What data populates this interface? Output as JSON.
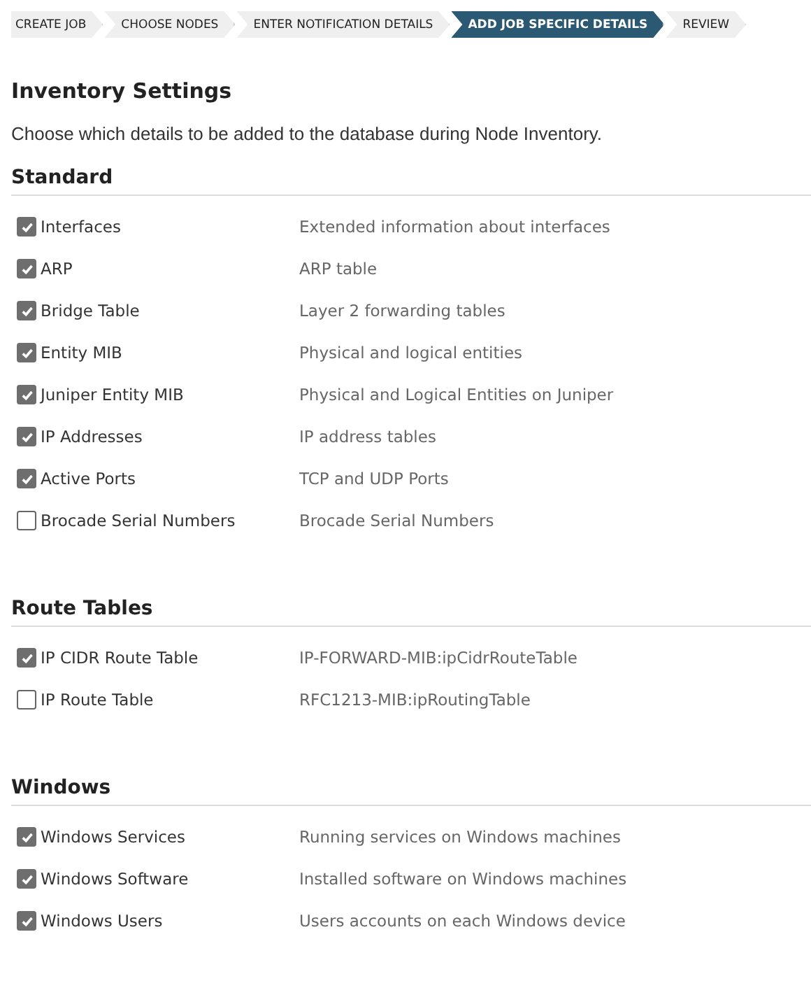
{
  "steps": [
    {
      "label": "CREATE JOB",
      "selected": false
    },
    {
      "label": "CHOOSE NODES",
      "selected": false
    },
    {
      "label": "ENTER NOTIFICATION DETAILS",
      "selected": false
    },
    {
      "label": "ADD JOB SPECIFIC DETAILS",
      "selected": true
    },
    {
      "label": "REVIEW",
      "selected": false
    }
  ],
  "title": "Inventory Settings",
  "description": "Choose which details to be added to the database during Node Inventory.",
  "sections": [
    {
      "heading": "Standard",
      "items": [
        {
          "label": "Interfaces",
          "detail": "Extended information about interfaces",
          "checked": true
        },
        {
          "label": "ARP",
          "detail": "ARP table",
          "checked": true
        },
        {
          "label": "Bridge Table",
          "detail": "Layer 2 forwarding tables",
          "checked": true
        },
        {
          "label": "Entity MIB",
          "detail": "Physical and logical entities",
          "checked": true
        },
        {
          "label": "Juniper Entity MIB",
          "detail": "Physical and Logical Entities on Juniper",
          "checked": true
        },
        {
          "label": "IP Addresses",
          "detail": "IP address tables",
          "checked": true
        },
        {
          "label": "Active Ports",
          "detail": "TCP and UDP Ports",
          "checked": true
        },
        {
          "label": "Brocade Serial Numbers",
          "detail": "Brocade Serial Numbers",
          "checked": false
        }
      ]
    },
    {
      "heading": "Route Tables",
      "items": [
        {
          "label": "IP CIDR Route Table",
          "detail": "IP-FORWARD-MIB:ipCidrRouteTable",
          "checked": true
        },
        {
          "label": "IP Route Table",
          "detail": "RFC1213-MIB:ipRoutingTable",
          "checked": false
        }
      ]
    },
    {
      "heading": "Windows",
      "items": [
        {
          "label": "Windows Services",
          "detail": "Running services on Windows machines",
          "checked": true
        },
        {
          "label": "Windows Software",
          "detail": "Installed software on Windows machines",
          "checked": true
        },
        {
          "label": "Windows Users",
          "detail": "Users accounts on each Windows device",
          "checked": true
        }
      ]
    }
  ]
}
